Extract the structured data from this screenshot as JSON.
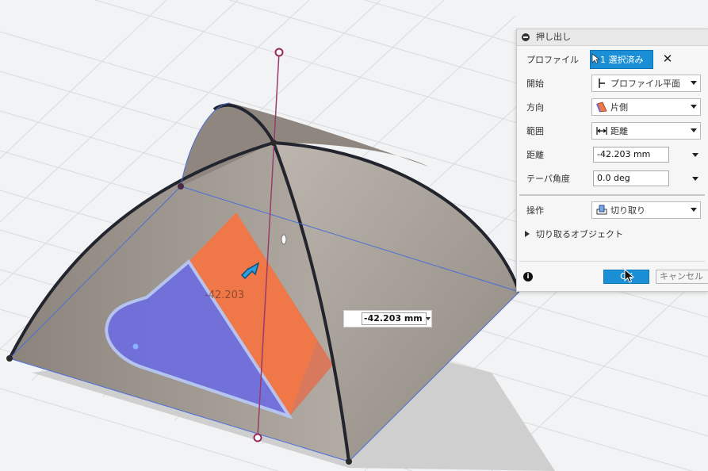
{
  "panel": {
    "title": "押し出し",
    "profile": {
      "label": "プロファイル",
      "value": "1 選択済み"
    },
    "start": {
      "label": "開始",
      "value": "プロファイル平面"
    },
    "direction": {
      "label": "方向",
      "value": "片側"
    },
    "extent": {
      "label": "範囲",
      "value": "距離"
    },
    "distance": {
      "label": "距離",
      "value": "-42.203 mm"
    },
    "taper": {
      "label": "テーパ角度",
      "value": "0.0 deg"
    },
    "operation": {
      "label": "操作",
      "value": "切り取り"
    },
    "objects_to_cut": "切り取るオブジェクト",
    "ok": "OK",
    "cancel": "キャンセル"
  },
  "canvas": {
    "dimension_input": "-42.203 mm",
    "ghost_dimension": "-42.203"
  },
  "colors": {
    "accent": "#1a8fd6",
    "cut_profile": "#6e6ee0",
    "cut_body": "#f07848",
    "body": "#9a8f84"
  }
}
